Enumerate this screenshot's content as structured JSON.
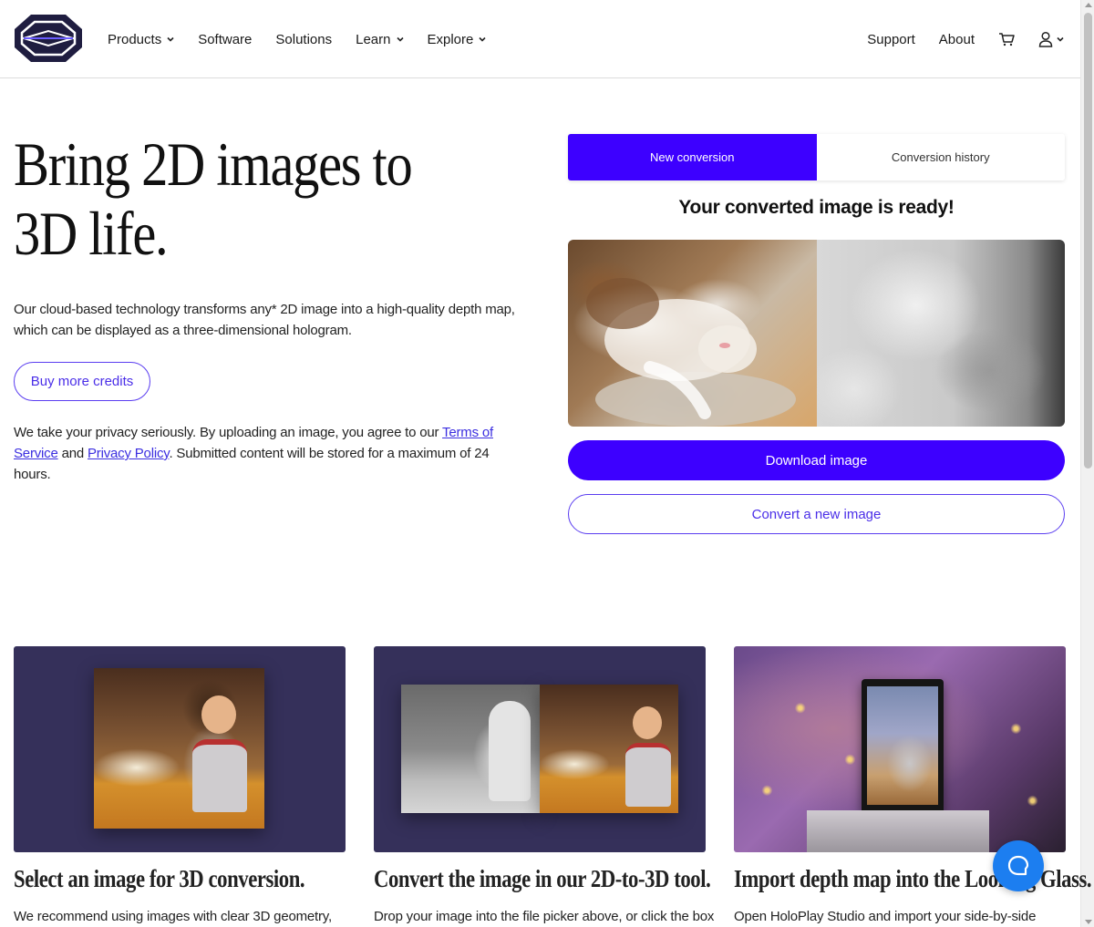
{
  "colors": {
    "accent": "#3d00ff",
    "outline": "#5a3df0",
    "card_bg": "#35305a",
    "chat": "#1c7ef0"
  },
  "nav": {
    "logo_icon": "looking-glass-logo-icon",
    "items": [
      {
        "label": "Products",
        "dropdown": true
      },
      {
        "label": "Software",
        "dropdown": false
      },
      {
        "label": "Solutions",
        "dropdown": false
      },
      {
        "label": "Learn",
        "dropdown": true
      },
      {
        "label": "Explore",
        "dropdown": true
      }
    ],
    "support": "Support",
    "about": "About",
    "cart_icon": "cart-icon",
    "account_icon": "user-icon"
  },
  "hero": {
    "title": "Bring 2D images to 3D life.",
    "description": "Our cloud-based technology transforms any* 2D image into a high-quality depth map, which can be displayed as a three-dimensional hologram.",
    "buy_credits": "Buy more credits",
    "privacy_before": "We take your privacy seriously. By uploading an image, you agree to our ",
    "terms_link": "Terms of Service",
    "privacy_mid": " and ",
    "privacy_link": "Privacy Policy",
    "privacy_after": ". Submitted content will be stored for a maximum of 24 hours."
  },
  "converter": {
    "tab_new": "New conversion",
    "tab_history": "Conversion history",
    "ready": "Your converted image is ready!",
    "download": "Download image",
    "convert_new": "Convert a new image"
  },
  "steps": [
    {
      "title": "Select an image for 3D conversion.",
      "desc": "We recommend using images with clear 3D geometry,"
    },
    {
      "title": "Convert the image in our 2D-to-3D tool.",
      "desc": "Drop your image into the file picker above, or click the box"
    },
    {
      "title": "Import depth map into the Looking Glass.",
      "desc": "Open HoloPlay Studio and import your side-by-side"
    }
  ],
  "chat_icon": "chat-bubble-icon"
}
